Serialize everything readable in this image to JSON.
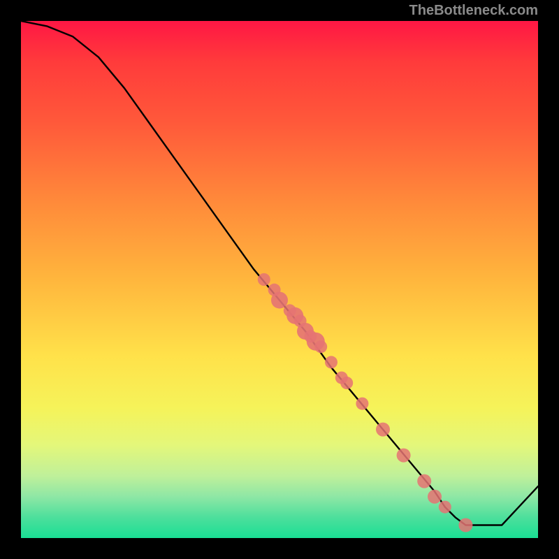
{
  "attribution": "TheBottleneck.com",
  "colors": {
    "background": "#000000",
    "dot": "#e57373",
    "curve": "#000000",
    "gradient_top": "#ff1744",
    "gradient_bottom": "#1adf94"
  },
  "chart_data": {
    "type": "line",
    "title": "",
    "xlabel": "",
    "ylabel": "",
    "xlim": [
      0,
      100
    ],
    "ylim": [
      0,
      100
    ],
    "grid": false,
    "legend": false,
    "series": [
      {
        "name": "bottleneck-curve",
        "x": [
          0,
          5,
          10,
          15,
          20,
          25,
          30,
          35,
          40,
          45,
          50,
          55,
          60,
          65,
          70,
          75,
          80,
          82,
          84,
          86,
          90,
          93,
          100
        ],
        "y": [
          100,
          99,
          97,
          93,
          87,
          80,
          73,
          66,
          59,
          52,
          46,
          40,
          33,
          27,
          21,
          15,
          9,
          6,
          4,
          2.5,
          2.5,
          2.5,
          10
        ]
      }
    ],
    "scatter_points": {
      "name": "highlighted-samples",
      "x": [
        47,
        49,
        50,
        52,
        53,
        54,
        55,
        56,
        57,
        58,
        60,
        62,
        63,
        66,
        70,
        74,
        78,
        80,
        82,
        86
      ],
      "y": [
        50,
        48,
        46,
        44,
        43,
        42,
        40,
        39,
        38,
        37,
        34,
        31,
        30,
        26,
        21,
        16,
        11,
        8,
        6,
        2.5
      ],
      "size": [
        9,
        9,
        12,
        9,
        12,
        9,
        12,
        9,
        13,
        9,
        9,
        9,
        9,
        9,
        10,
        10,
        10,
        10,
        9,
        10
      ]
    }
  }
}
